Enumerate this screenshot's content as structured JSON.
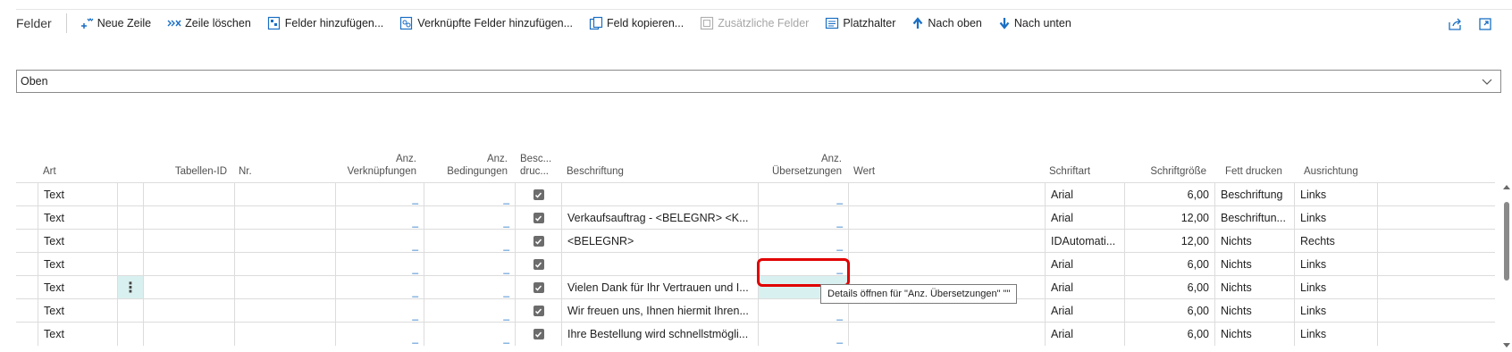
{
  "toolbar": {
    "title": "Felder",
    "buttons": [
      {
        "label": "Neue Zeile",
        "icon": "new-line-icon",
        "disabled": false
      },
      {
        "label": "Zeile löschen",
        "icon": "delete-line-icon",
        "disabled": false
      },
      {
        "label": "Felder hinzufügen...",
        "icon": "add-fields-icon",
        "disabled": false
      },
      {
        "label": "Verknüpfte Felder hinzufügen...",
        "icon": "add-linked-fields-icon",
        "disabled": false
      },
      {
        "label": "Feld kopieren...",
        "icon": "copy-field-icon",
        "disabled": false
      },
      {
        "label": "Zusätzliche Felder",
        "icon": "additional-fields-icon",
        "disabled": true
      },
      {
        "label": "Platzhalter",
        "icon": "placeholder-icon",
        "disabled": false
      },
      {
        "label": "Nach oben",
        "icon": "arrow-up-icon",
        "disabled": false
      },
      {
        "label": "Nach unten",
        "icon": "arrow-down-icon",
        "disabled": false
      }
    ]
  },
  "section_select": {
    "value": "Oben"
  },
  "columns": {
    "art": "Art",
    "tabellen_id": "Tabellen-ID",
    "nr": "Nr.",
    "anz_verk_1": "Anz.",
    "anz_verk_2": "Verknüpfungen",
    "anz_bed_1": "Anz.",
    "anz_bed_2": "Bedingungen",
    "besc_1": "Besc...",
    "besc_2": "druc...",
    "beschriftung": "Beschriftung",
    "anz_ueb_1": "Anz.",
    "anz_ueb_2": "Übersetzungen",
    "wert": "Wert",
    "schriftart": "Schriftart",
    "schriftgroesse": "Schriftgröße",
    "fett": "Fett drucken",
    "ausrichtung": "Ausrichtung"
  },
  "rows": [
    {
      "art": "Text",
      "verk": "_",
      "bed": "_",
      "printed": true,
      "beschriftung": "",
      "ueb": "_",
      "schriftart": "Arial",
      "groesse": "6,00",
      "fett": "Beschriftung",
      "ausrichtung": "Links"
    },
    {
      "art": "Text",
      "verk": "_",
      "bed": "_",
      "printed": true,
      "beschriftung": "Verkaufsauftrag - <BELEGNR> <K...",
      "ueb": "_",
      "schriftart": "Arial",
      "groesse": "12,00",
      "fett": "Beschriftun...",
      "ausrichtung": "Links"
    },
    {
      "art": "Text",
      "verk": "_",
      "bed": "_",
      "printed": true,
      "beschriftung": "<BELEGNR>",
      "ueb": "_",
      "schriftart": "IDAutomati...",
      "groesse": "12,00",
      "fett": "Nichts",
      "ausrichtung": "Rechts"
    },
    {
      "art": "Text",
      "verk": "_",
      "bed": "_",
      "printed": true,
      "beschriftung": "",
      "ueb": "_",
      "schriftart": "Arial",
      "groesse": "6,00",
      "fett": "Nichts",
      "ausrichtung": "Links"
    },
    {
      "art": "Text",
      "verk": "_",
      "bed": "_",
      "printed": true,
      "beschriftung": "Vielen Dank für Ihr Vertrauen und I...",
      "ueb": "_",
      "schriftart": "Arial",
      "groesse": "6,00",
      "fett": "Nichts",
      "ausrichtung": "Links"
    },
    {
      "art": "Text",
      "verk": "_",
      "bed": "_",
      "printed": true,
      "beschriftung": "Wir freuen uns, Ihnen hiermit Ihren...",
      "ueb": "_",
      "schriftart": "Arial",
      "groesse": "6,00",
      "fett": "Nichts",
      "ausrichtung": "Links"
    },
    {
      "art": "Text",
      "verk": "_",
      "bed": "_",
      "printed": true,
      "beschriftung": "Ihre Bestellung wird schnellstmögli...",
      "ueb": "_",
      "schriftart": "Arial",
      "groesse": "6,00",
      "fett": "Nichts",
      "ausrichtung": "Links"
    }
  ],
  "row_menu_glyph": "⋮",
  "tooltip": {
    "text": "Details öffnen für \"Anz. Übersetzungen\" \"\""
  },
  "colors": {
    "accent": "#1a6fc4",
    "highlight": "#d9f0f0",
    "focus_ring": "#e10000"
  }
}
